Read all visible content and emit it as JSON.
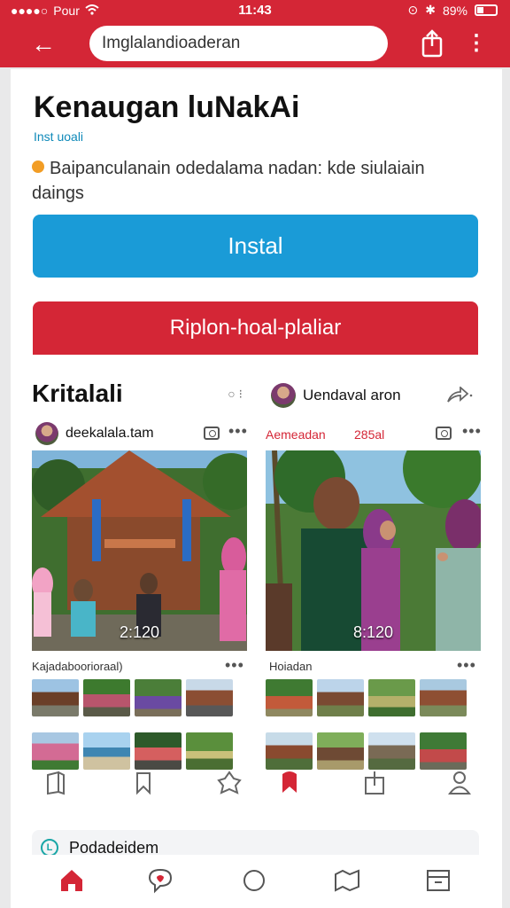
{
  "status_bar": {
    "carrier": "Pour",
    "time": "11:43",
    "battery": "89%"
  },
  "app_bar": {
    "url": "Imglalandioaderan"
  },
  "app": {
    "title": "Kenaugan luNakAi",
    "subtitle": "Inst uoali",
    "description": "Baipanculanain odedalama nadan: kde siulaiain daings",
    "install_label": "Instal",
    "secondary_label": "Riplon-hoal-plaliar"
  },
  "feed": {
    "left": {
      "section_title": "Kritalali",
      "username": "deekalala.tam",
      "timestamp": "2:120",
      "caption": "Kajadaboorioraal)"
    },
    "right": {
      "header_name": "Uendaval aron",
      "username": "Aemeadan",
      "count": "285al",
      "timestamp": "8:120",
      "caption": "Hoiadan"
    }
  },
  "promo": {
    "label": "Podadeidem"
  },
  "colors": {
    "brand_red": "#d42636",
    "install_blue": "#1a9bd7",
    "teal": "#1aa6a6"
  },
  "icons": {
    "actions": [
      "bookmark-icon",
      "bookmark-outline-icon",
      "puzzle-icon",
      "bookmark-filled-icon",
      "share-box-icon",
      "person-icon"
    ],
    "nav": [
      "home-icon",
      "heart-chat-icon",
      "circle-icon",
      "map-icon",
      "archive-icon"
    ]
  }
}
